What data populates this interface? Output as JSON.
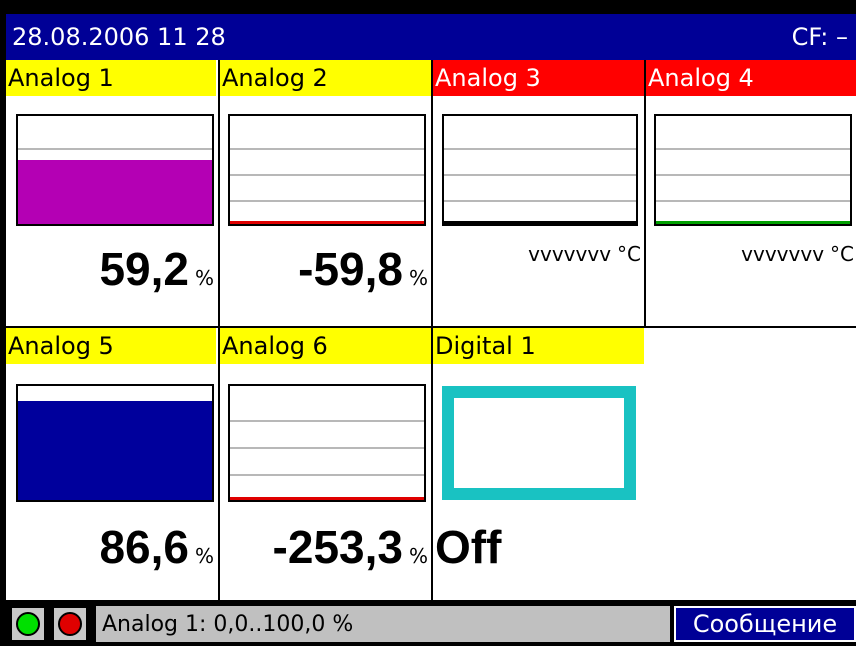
{
  "titlebar": {
    "datetime": "28.08.2006 11 28",
    "cf": "CF: –"
  },
  "channels": [
    {
      "name": "Analog 1",
      "header_color": "yellow",
      "fill_level": 0.59,
      "fill_color": "#b400b4",
      "base_color": "",
      "value": "59,2",
      "unit": "%"
    },
    {
      "name": "Analog 2",
      "header_color": "yellow",
      "fill_level": 0.0,
      "fill_color": "",
      "base_color": "#e00000",
      "value": "-59,8",
      "unit": "%"
    },
    {
      "name": "Analog 3",
      "header_color": "red",
      "fill_level": 0.0,
      "fill_color": "",
      "base_color": "#000000",
      "value": "vvvvvvv",
      "unit": "°C"
    },
    {
      "name": "Analog 4",
      "header_color": "red",
      "fill_level": 0.0,
      "fill_color": "",
      "base_color": "#00a000",
      "value": "vvvvvvv",
      "unit": "°C"
    },
    {
      "name": "Analog 5",
      "header_color": "yellow",
      "fill_level": 0.866,
      "fill_color": "#00009c",
      "base_color": "",
      "value": "86,6",
      "unit": "%"
    },
    {
      "name": "Analog 6",
      "header_color": "yellow",
      "fill_level": 0.0,
      "fill_color": "",
      "base_color": "#e00000",
      "value": "-253,3",
      "unit": "%"
    }
  ],
  "digital": {
    "name": "Digital 1",
    "state": "Off",
    "box_color": "#19c2c2"
  },
  "statusbar": {
    "led1_color": "#00e000",
    "led2_color": "#e00000",
    "text": "Analog 1: 0,0..100,0 %",
    "message_label": "Сообщение"
  }
}
